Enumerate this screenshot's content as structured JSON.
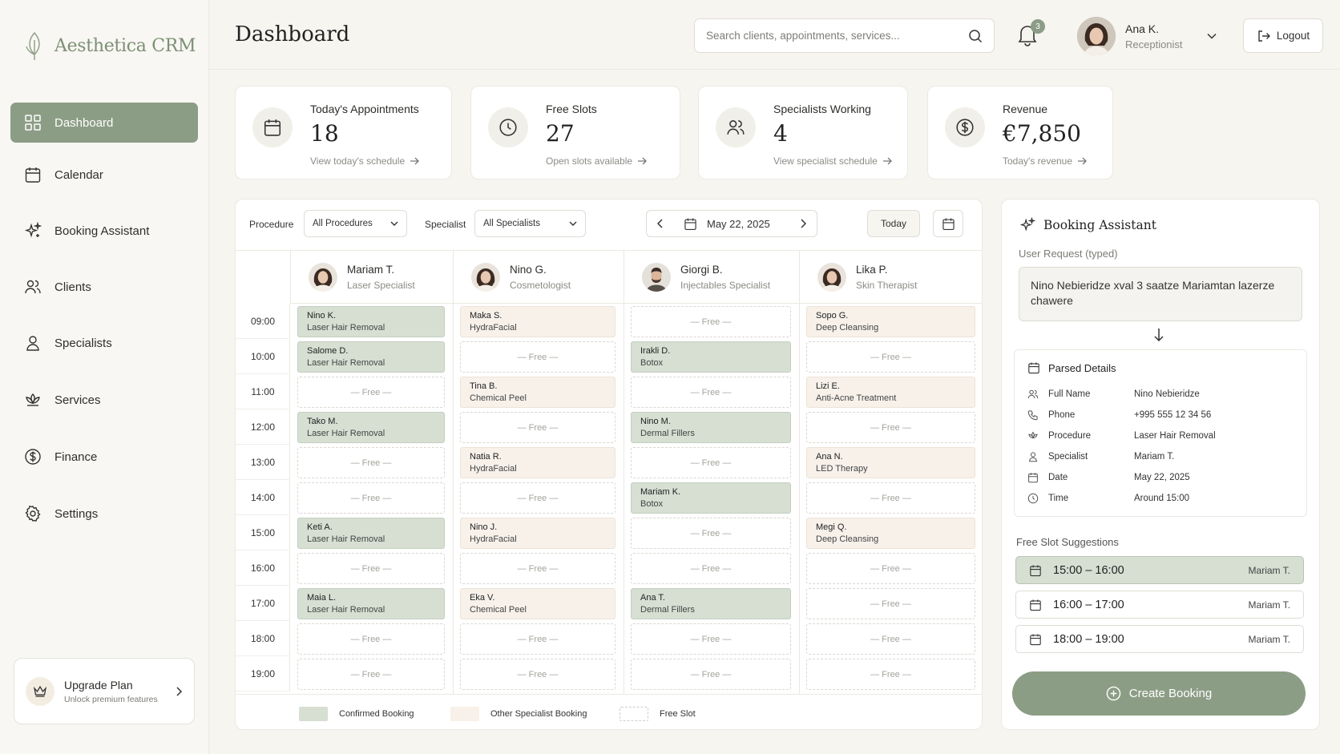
{
  "app": {
    "name": "Aesthetica CRM"
  },
  "sidebar": {
    "items": [
      {
        "label": "Dashboard",
        "icon": "grid-icon",
        "active": true
      },
      {
        "label": "Calendar",
        "icon": "calendar-icon"
      },
      {
        "label": "Booking Assistant",
        "icon": "sparkles-icon"
      },
      {
        "label": "Clients",
        "icon": "users-icon"
      },
      {
        "label": "Specialists",
        "icon": "user-icon"
      },
      {
        "label": "Services",
        "icon": "lotus-icon"
      },
      {
        "label": "Finance",
        "icon": "dollar-circle-icon"
      },
      {
        "label": "Settings",
        "icon": "gear-icon"
      }
    ],
    "upgrade": {
      "title": "Upgrade Plan",
      "subtitle": "Unlock premium features"
    }
  },
  "header": {
    "title": "Dashboard",
    "search_placeholder": "Search clients, appointments, services...",
    "notifications": "3",
    "user": {
      "name": "Ana K.",
      "role": "Receptionist"
    },
    "logout": "Logout"
  },
  "stats": [
    {
      "label": "Today's Appointments",
      "value": "18",
      "link": "View today's schedule",
      "icon": "calendar-icon"
    },
    {
      "label": "Free Slots",
      "value": "27",
      "link": "Open slots available",
      "icon": "clock-icon"
    },
    {
      "label": "Specialists Working",
      "value": "4",
      "link": "View specialist schedule",
      "icon": "users-icon"
    },
    {
      "label": "Revenue",
      "value": "€7,850",
      "link": "Today's revenue",
      "icon": "dollar-circle-icon"
    }
  ],
  "schedule": {
    "filters": {
      "procedure_label": "Procedure",
      "procedure_value": "All Procedures",
      "specialist_label": "Specialist",
      "specialist_value": "All Specialists"
    },
    "date": "May 22, 2025",
    "today": "Today",
    "times": [
      "09:00",
      "10:00",
      "11:00",
      "12:00",
      "13:00",
      "14:00",
      "15:00",
      "16:00",
      "17:00",
      "18:00",
      "19:00"
    ],
    "free_label": "— Free —",
    "specialists": [
      {
        "name": "Mariam T.",
        "role": "Laser Specialist",
        "avatar": "female",
        "slots": [
          {
            "s": "confirmed",
            "c": "Nino K.",
            "p": "Laser Hair Removal"
          },
          {
            "s": "confirmed",
            "c": "Salome D.",
            "p": "Laser Hair Removal"
          },
          {
            "s": "free"
          },
          {
            "s": "confirmed",
            "c": "Tako M.",
            "p": "Laser Hair Removal"
          },
          {
            "s": "free"
          },
          {
            "s": "free"
          },
          {
            "s": "confirmed",
            "c": "Keti A.",
            "p": "Laser Hair Removal"
          },
          {
            "s": "free"
          },
          {
            "s": "confirmed",
            "c": "Maia L.",
            "p": "Laser Hair Removal"
          },
          {
            "s": "free"
          },
          {
            "s": "free"
          }
        ]
      },
      {
        "name": "Nino G.",
        "role": "Cosmetologist",
        "avatar": "female",
        "slots": [
          {
            "s": "other",
            "c": "Maka S.",
            "p": "HydraFacial"
          },
          {
            "s": "free"
          },
          {
            "s": "other",
            "c": "Tina B.",
            "p": "Chemical Peel"
          },
          {
            "s": "free"
          },
          {
            "s": "other",
            "c": "Natia R.",
            "p": "HydraFacial"
          },
          {
            "s": "free"
          },
          {
            "s": "other",
            "c": "Nino J.",
            "p": "HydraFacial"
          },
          {
            "s": "free"
          },
          {
            "s": "other",
            "c": "Eka V.",
            "p": "Chemical Peel"
          },
          {
            "s": "free"
          },
          {
            "s": "free"
          }
        ]
      },
      {
        "name": "Giorgi B.",
        "role": "Injectables Specialist",
        "avatar": "male",
        "slots": [
          {
            "s": "free"
          },
          {
            "s": "confirmed",
            "c": "Irakli D.",
            "p": "Botox"
          },
          {
            "s": "free"
          },
          {
            "s": "confirmed",
            "c": "Nino M.",
            "p": "Dermal Fillers"
          },
          {
            "s": "free"
          },
          {
            "s": "confirmed",
            "c": "Mariam K.",
            "p": "Botox"
          },
          {
            "s": "free"
          },
          {
            "s": "free"
          },
          {
            "s": "confirmed",
            "c": "Ana T.",
            "p": "Dermal Fillers"
          },
          {
            "s": "free"
          },
          {
            "s": "free"
          }
        ]
      },
      {
        "name": "Lika P.",
        "role": "Skin Therapist",
        "avatar": "female",
        "slots": [
          {
            "s": "other",
            "c": "Sopo G.",
            "p": "Deep Cleansing"
          },
          {
            "s": "free"
          },
          {
            "s": "other",
            "c": "Lizi E.",
            "p": "Anti-Acne Treatment"
          },
          {
            "s": "free"
          },
          {
            "s": "other",
            "c": "Ana N.",
            "p": "LED Therapy"
          },
          {
            "s": "free"
          },
          {
            "s": "other",
            "c": "Megi Q.",
            "p": "Deep Cleansing"
          },
          {
            "s": "free"
          },
          {
            "s": "free"
          },
          {
            "s": "free"
          },
          {
            "s": "free"
          }
        ]
      }
    ],
    "legend": {
      "confirmed": "Confirmed Booking",
      "other": "Other Specialist Booking",
      "free": "Free Slot"
    }
  },
  "assistant": {
    "title": "Booking Assistant",
    "request_label": "User Request (typed)",
    "request_text": "Nino Nebieridze xval 3 saatze Mariamtan lazerze chawere",
    "parsed_title": "Parsed Details",
    "parsed": [
      {
        "k": "Full Name",
        "v": "Nino Nebieridze",
        "icon": "users-icon"
      },
      {
        "k": "Phone",
        "v": "+995 555 12 34 56",
        "icon": "phone-icon"
      },
      {
        "k": "Procedure",
        "v": "Laser Hair Removal",
        "icon": "lotus-icon"
      },
      {
        "k": "Specialist",
        "v": "Mariam T.",
        "icon": "user-icon"
      },
      {
        "k": "Date",
        "v": "May 22, 2025",
        "icon": "calendar-icon"
      },
      {
        "k": "Time",
        "v": "Around 15:00",
        "icon": "clock-icon"
      }
    ],
    "suggestions_title": "Free Slot Suggestions",
    "suggestions": [
      {
        "time": "15:00 – 16:00",
        "specialist": "Mariam T.",
        "selected": true
      },
      {
        "time": "16:00 – 17:00",
        "specialist": "Mariam T."
      },
      {
        "time": "18:00 – 19:00",
        "specialist": "Mariam T."
      }
    ],
    "create": "Create Booking"
  },
  "colors": {
    "accent": "#8c9d85",
    "confirmed": "#d6dfd2",
    "other": "#f7f1ea",
    "bg": "#f6f5f0"
  }
}
